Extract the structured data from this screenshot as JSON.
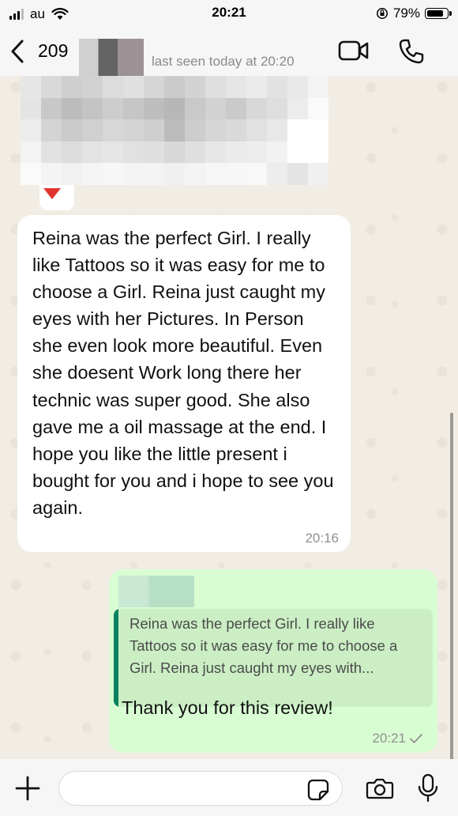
{
  "status_bar": {
    "carrier": "au",
    "time": "20:21",
    "battery": "79%"
  },
  "header": {
    "contact_name": "209",
    "last_seen": "last seen today at 20:20"
  },
  "messages": {
    "incoming": {
      "text": "Reina was the perfect Girl. I really like Tattoos so it was easy for me to choose a Girl. Reina just caught my eyes with her Pictures. In Person she even look more beautiful. Even she doesent Work long there her technic was super good. She also gave me a oil massage at the end. I hope you like the little present i bought for you and i hope to see you again.",
      "time": "20:16"
    },
    "outgoing": {
      "quoted_text": "Reina was the perfect Girl. I really like Tattoos so it was easy for me to choose a Girl. Reina just caught my eyes with...",
      "text": "Thank you for this review!",
      "time": "20:21"
    }
  },
  "input": {
    "placeholder": ""
  },
  "colors": {
    "accent": "#06825f",
    "outgoing_bubble": "#d9fdd3",
    "incoming_bubble": "#ffffff"
  }
}
